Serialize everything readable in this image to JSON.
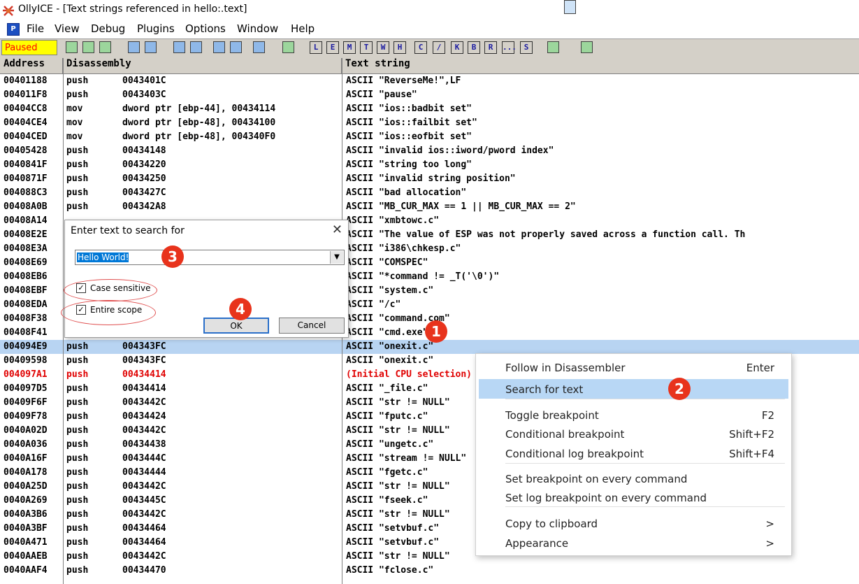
{
  "window": {
    "title": "OllyICE - [Text strings referenced in hello:.text]"
  },
  "menu": [
    "File",
    "View",
    "Debug",
    "Plugins",
    "Options",
    "Window",
    "Help"
  ],
  "toolbar": {
    "status": "Paused",
    "letters": [
      "L",
      "E",
      "M",
      "T",
      "W",
      "H",
      "C",
      "/",
      "K",
      "B",
      "R",
      "...",
      "S"
    ]
  },
  "columns": {
    "address": "Address",
    "disassembly": "Disassembly",
    "text": "Text string"
  },
  "rows": [
    {
      "addr": "00401188",
      "op": "push",
      "arg": "0043401C",
      "text": "ASCII \"ReverseMe!\",LF"
    },
    {
      "addr": "004011F8",
      "op": "push",
      "arg": "0043403C",
      "text": "ASCII \"pause\""
    },
    {
      "addr": "00404CC8",
      "op": "mov",
      "arg": "dword ptr [ebp-44], 00434114",
      "text": "ASCII \"ios::badbit set\""
    },
    {
      "addr": "00404CE4",
      "op": "mov",
      "arg": "dword ptr [ebp-48], 00434100",
      "text": "ASCII \"ios::failbit set\""
    },
    {
      "addr": "00404CED",
      "op": "mov",
      "arg": "dword ptr [ebp-48], 004340F0",
      "text": "ASCII \"ios::eofbit set\""
    },
    {
      "addr": "00405428",
      "op": "push",
      "arg": "00434148",
      "text": "ASCII \"invalid ios::iword/pword index\""
    },
    {
      "addr": "0040841F",
      "op": "push",
      "arg": "00434220",
      "text": "ASCII \"string too long\""
    },
    {
      "addr": "0040871F",
      "op": "push",
      "arg": "00434250",
      "text": "ASCII \"invalid string position\""
    },
    {
      "addr": "004088C3",
      "op": "push",
      "arg": "0043427C",
      "text": "ASCII \"bad allocation\""
    },
    {
      "addr": "00408A0B",
      "op": "push",
      "arg": "004342A8",
      "text": "ASCII \"MB_CUR_MAX == 1 || MB_CUR_MAX == 2\""
    },
    {
      "addr": "00408A14",
      "op": "",
      "arg": "",
      "text": "ASCII \"xmbtowc.c\""
    },
    {
      "addr": "00408E2E",
      "op": "",
      "arg": "",
      "text": "ASCII \"The value of ESP was not properly saved across a function call.  Th"
    },
    {
      "addr": "00408E3A",
      "op": "",
      "arg": "",
      "text": "ASCII \"i386\\chkesp.c\""
    },
    {
      "addr": "00408E69",
      "op": "",
      "arg": "",
      "text": "ASCII \"COMSPEC\""
    },
    {
      "addr": "00408EB6",
      "op": "",
      "arg": "",
      "text": "ASCII \"*command != _T('\\0')\""
    },
    {
      "addr": "00408EBF",
      "op": "",
      "arg": "",
      "text": "ASCII \"system.c\""
    },
    {
      "addr": "00408EDA",
      "op": "",
      "arg": "",
      "text": "ASCII \"/c\""
    },
    {
      "addr": "00408F38",
      "op": "",
      "arg": "",
      "text": "ASCII \"command.com\""
    },
    {
      "addr": "00408F41",
      "op": "",
      "arg": "",
      "text": "ASCII \"cmd.exe\""
    },
    {
      "addr": "004094E9",
      "op": "push",
      "arg": "004343FC",
      "text": "ASCII \"onexit.c\"",
      "sel": true
    },
    {
      "addr": "00409598",
      "op": "push",
      "arg": "004343FC",
      "text": "ASCII \"onexit.c\""
    },
    {
      "addr": "004097A1",
      "op": "push",
      "arg": "00434414",
      "text": "(Initial CPU selection)",
      "red": true
    },
    {
      "addr": "004097D5",
      "op": "push",
      "arg": "00434414",
      "text": "ASCII \"_file.c\""
    },
    {
      "addr": "00409F6F",
      "op": "push",
      "arg": "0043442C",
      "text": "ASCII \"str != NULL\""
    },
    {
      "addr": "00409F78",
      "op": "push",
      "arg": "00434424",
      "text": "ASCII \"fputc.c\""
    },
    {
      "addr": "0040A02D",
      "op": "push",
      "arg": "0043442C",
      "text": "ASCII \"str != NULL\""
    },
    {
      "addr": "0040A036",
      "op": "push",
      "arg": "00434438",
      "text": "ASCII \"ungetc.c\""
    },
    {
      "addr": "0040A16F",
      "op": "push",
      "arg": "0043444C",
      "text": "ASCII \"stream != NULL\""
    },
    {
      "addr": "0040A178",
      "op": "push",
      "arg": "00434444",
      "text": "ASCII \"fgetc.c\""
    },
    {
      "addr": "0040A25D",
      "op": "push",
      "arg": "0043442C",
      "text": "ASCII \"str != NULL\""
    },
    {
      "addr": "0040A269",
      "op": "push",
      "arg": "0043445C",
      "text": "ASCII \"fseek.c\""
    },
    {
      "addr": "0040A3B6",
      "op": "push",
      "arg": "0043442C",
      "text": "ASCII \"str != NULL\""
    },
    {
      "addr": "0040A3BF",
      "op": "push",
      "arg": "00434464",
      "text": "ASCII \"setvbuf.c\""
    },
    {
      "addr": "0040A471",
      "op": "push",
      "arg": "00434464",
      "text": "ASCII \"setvbuf.c\""
    },
    {
      "addr": "0040AAEB",
      "op": "push",
      "arg": "0043442C",
      "text": "ASCII \"str != NULL\""
    },
    {
      "addr": "0040AAF4",
      "op": "push",
      "arg": "00434470",
      "text": "ASCII \"fclose.c\""
    }
  ],
  "dialog": {
    "title": "Enter text to search for",
    "value": "Hello World!",
    "case_sensitive": "Case sensitive",
    "entire_scope": "Entire scope",
    "ok": "OK",
    "cancel": "Cancel"
  },
  "context_menu": [
    {
      "label": "Follow in Disassembler",
      "shortcut": "Enter"
    },
    {
      "label": "Search for text",
      "shortcut": "",
      "highlight": true
    },
    {
      "label": "Toggle breakpoint",
      "shortcut": "F2"
    },
    {
      "label": "Conditional breakpoint",
      "shortcut": "Shift+F2"
    },
    {
      "label": "Conditional log breakpoint",
      "shortcut": "Shift+F4"
    },
    {
      "label": "Set breakpoint on every command",
      "shortcut": ""
    },
    {
      "label": "Set log breakpoint on every command",
      "shortcut": ""
    },
    {
      "label": "Copy to clipboard",
      "shortcut": ">"
    },
    {
      "label": "Appearance",
      "shortcut": ">"
    }
  ],
  "badges": [
    "1",
    "2",
    "3",
    "4"
  ],
  "colors": {
    "selection": "#b8d4f2",
    "highlight": "#b8d7f5",
    "badge": "#e8331c",
    "status_bg": "#ffff00",
    "status_fg": "#ff0000",
    "red_row": "#e00000"
  }
}
